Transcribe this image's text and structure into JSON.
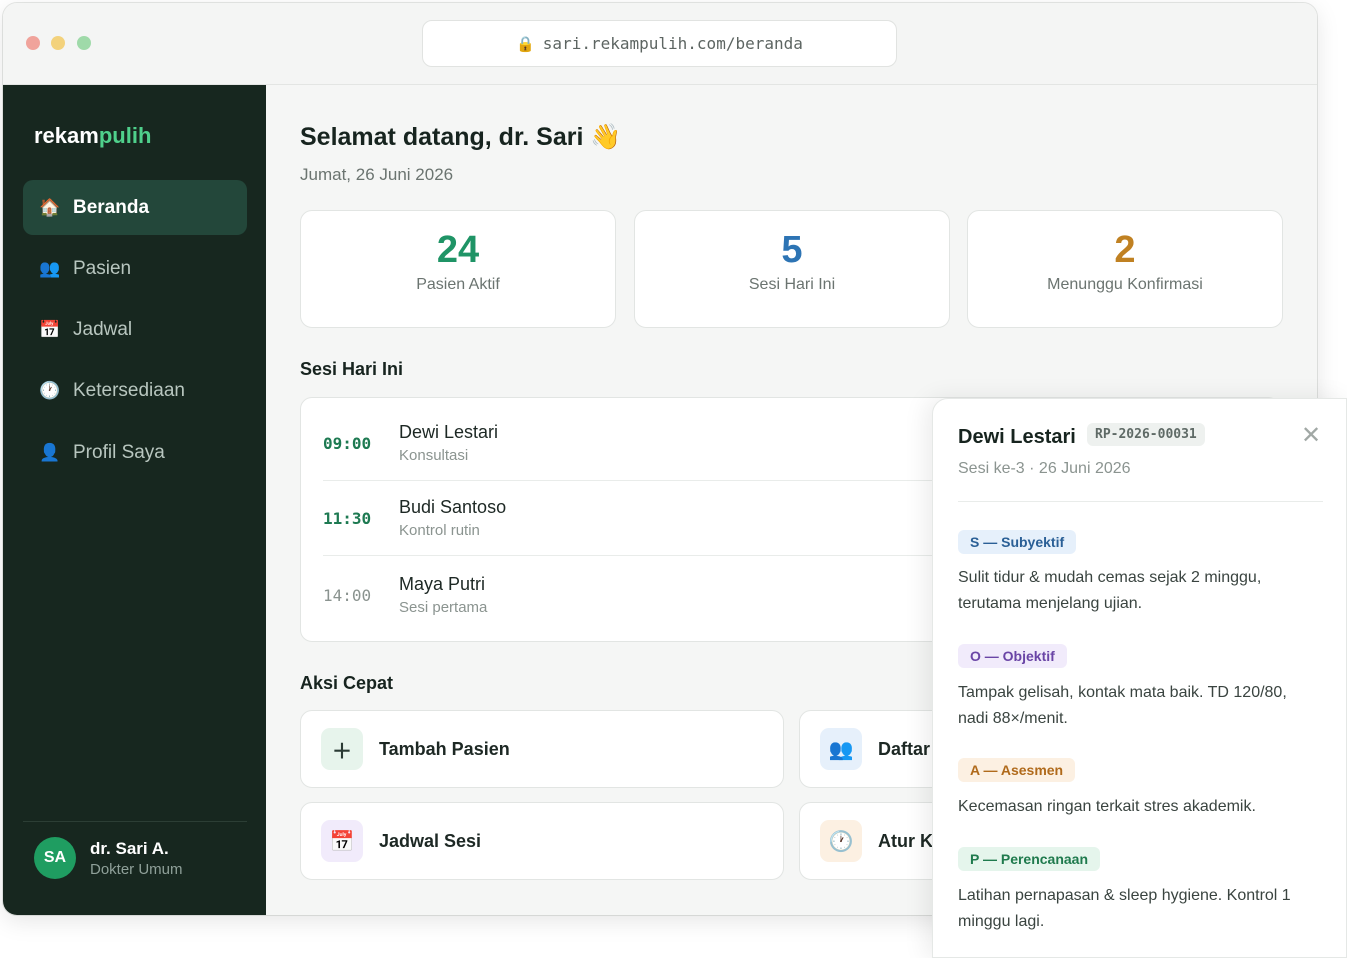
{
  "browser": {
    "url": "sari.rekampulih.com/beranda"
  },
  "sidebar": {
    "logo_main": "rekam",
    "logo_accent": "pulih",
    "items": [
      {
        "label": "Beranda",
        "icon": "🏠"
      },
      {
        "label": "Pasien",
        "icon": "👥"
      },
      {
        "label": "Jadwal",
        "icon": "📅"
      },
      {
        "label": "Ketersediaan",
        "icon": "🕐"
      },
      {
        "label": "Profil Saya",
        "icon": "👤"
      }
    ],
    "user": {
      "initials": "SA",
      "name": "dr. Sari A.",
      "role": "Dokter Umum"
    }
  },
  "main": {
    "greeting": "Selamat datang, dr. Sari 👋",
    "date": "Jumat, 26 Juni 2026",
    "stats": [
      {
        "value": "24",
        "label": "Pasien Aktif",
        "color": "#1f9466"
      },
      {
        "value": "5",
        "label": "Sesi Hari Ini",
        "color": "#2d74b4"
      },
      {
        "value": "2",
        "label": "Menunggu Konfirmasi",
        "color": "#c08122"
      }
    ],
    "sessions_title": "Sesi Hari Ini",
    "sessions": [
      {
        "time": "09:00",
        "name": "Dewi Lestari",
        "type": "Konsultasi"
      },
      {
        "time": "11:30",
        "name": "Budi Santoso",
        "type": "Kontrol rutin"
      },
      {
        "time": "14:00",
        "name": "Maya Putri",
        "type": "Sesi pertama"
      }
    ],
    "actions_title": "Aksi Cepat",
    "actions": [
      {
        "label": "Tambah Pasien",
        "icon": "＋"
      },
      {
        "label": "Daftar",
        "icon": "👥"
      },
      {
        "label": "Jadwal Sesi",
        "icon": "📅"
      },
      {
        "label": "Atur K",
        "icon": "🕐"
      }
    ]
  },
  "panel": {
    "name": "Dewi Lestari",
    "id": "RP-2026-00031",
    "meta": "Sesi ke-3 · 26 Juni 2026",
    "close": "✕",
    "soap": [
      {
        "tag": "S — Subyektif",
        "text": "Sulit tidur & mudah cemas sejak 2 minggu, terutama menjelang ujian.",
        "bg": "#e6f0fb",
        "fg": "#2a5f96"
      },
      {
        "tag": "O — Objektif",
        "text": "Tampak gelisah, kontak mata baik. TD 120/80, nadi 88×/menit.",
        "bg": "#f1ebfb",
        "fg": "#6a45a6"
      },
      {
        "tag": "A — Asesmen",
        "text": "Kecemasan ringan terkait stres akademik.",
        "bg": "#fcf0e2",
        "fg": "#b06a1b"
      },
      {
        "tag": "P — Perencanaan",
        "text": "Latihan pernapasan & sleep hygiene. Kontrol 1 minggu lagi.",
        "bg": "#e5f5ec",
        "fg": "#1f7a4d"
      }
    ]
  }
}
